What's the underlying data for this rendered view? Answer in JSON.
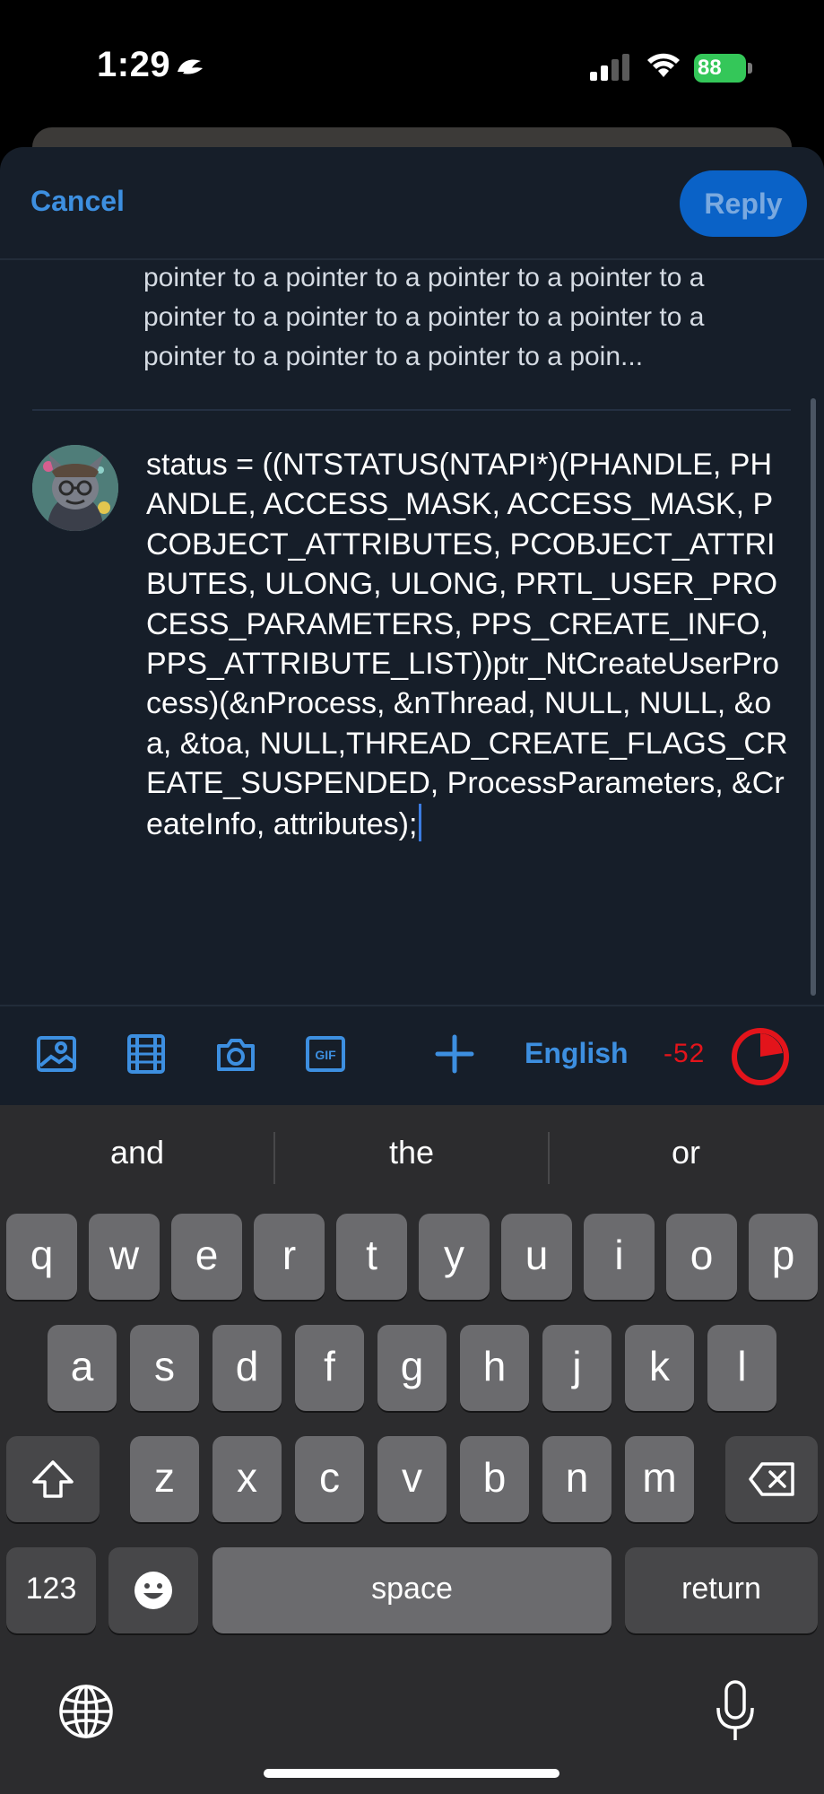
{
  "status_bar": {
    "time": "1:29",
    "battery_level": "88"
  },
  "compose": {
    "cancel_label": "Cancel",
    "reply_label": "Reply",
    "quoted_text": "pointer to a pointer to a pointer to a pointer to a pointer to a pointer to a pointer to a pointer to a pointer to a pointer to a pointer to a poin...",
    "reply_text": "status = ((NTSTATUS(NTAPI*)(PHANDLE, PHANDLE, ACCESS_MASK, ACCESS_MASK, PCOBJECT_ATTRIBUTES, PCOBJECT_ATTRIBUTES, ULONG, ULONG, PRTL_USER_PROCESS_PARAMETERS, PPS_CREATE_INFO, PPS_ATTRIBUTE_LIST))ptr_NtCreateUserProcess)(&nProcess, &nThread,  NULL, NULL, &oa, &toa, NULL,THREAD_CREATE_FLAGS_CREATE_SUSPENDED, ProcessParameters, &CreateInfo, attributes);"
  },
  "toolbar": {
    "icons": [
      "image-icon",
      "video-icon",
      "camera-icon",
      "gif-icon",
      "plus-icon"
    ],
    "language_label": "English",
    "char_count": "-52",
    "accent_color": "#3d8fe0",
    "over_limit_color": "#e3141b"
  },
  "keyboard": {
    "suggestions": [
      "and",
      "the",
      "or"
    ],
    "row1": [
      "q",
      "w",
      "e",
      "r",
      "t",
      "y",
      "u",
      "i",
      "o",
      "p"
    ],
    "row2": [
      "a",
      "s",
      "d",
      "f",
      "g",
      "h",
      "j",
      "k",
      "l"
    ],
    "row3": [
      "z",
      "x",
      "c",
      "v",
      "b",
      "n",
      "m"
    ],
    "numbers_label": "123",
    "space_label": "space",
    "return_label": "return"
  }
}
